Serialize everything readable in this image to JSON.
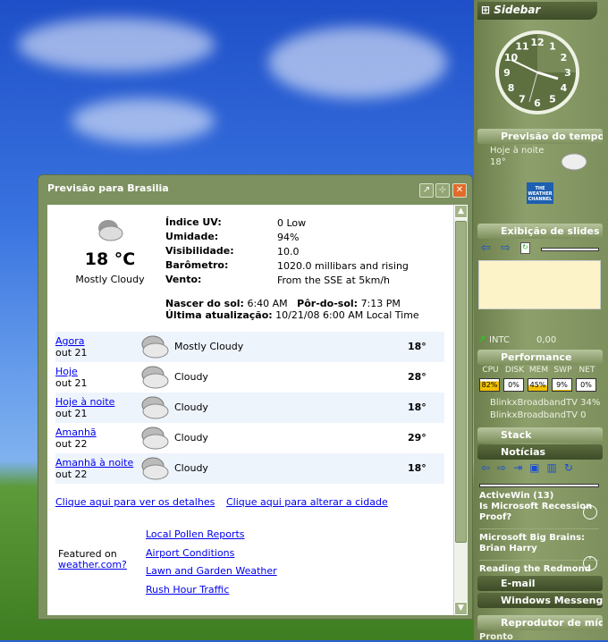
{
  "window": {
    "title": "Previsão para Brasilia",
    "buttons": {
      "undock": "↗",
      "pin": "⊹",
      "close": "✕"
    }
  },
  "current": {
    "temp": "18 °C",
    "condition": "Mostly Cloudy",
    "details": [
      {
        "label": "Índice UV:",
        "value": "0 Low"
      },
      {
        "label": "Umidade:",
        "value": "94%"
      },
      {
        "label": "Visibilidade:",
        "value": "10.0"
      },
      {
        "label": "Barômetro:",
        "value": "1020.0 millibars and rising"
      },
      {
        "label": "Vento:",
        "value": "From the SSE at 5km/h"
      }
    ],
    "sunrise_label": "Nascer do sol:",
    "sunrise": "6:40 AM",
    "sunset_label": "Pôr-do-sol:",
    "sunset": "7:13 PM",
    "updated_label": "Última atualização:",
    "updated": "10/21/08 6:00 AM Local Time"
  },
  "forecast": [
    {
      "period": "Agora",
      "date": "out 21",
      "condition": "Mostly Cloudy",
      "temp": "18°"
    },
    {
      "period": "Hoje",
      "date": "out 21",
      "condition": "Cloudy",
      "temp": "28°"
    },
    {
      "period": "Hoje à noite",
      "date": "out 21",
      "condition": "Cloudy",
      "temp": "18°"
    },
    {
      "period": "Amanhã",
      "date": "out 22",
      "condition": "Cloudy",
      "temp": "29°"
    },
    {
      "period": "Amanhã à noite",
      "date": "out 22",
      "condition": "Cloudy",
      "temp": "18°"
    }
  ],
  "links": {
    "details": "Clique aqui para ver os detalhes",
    "change_city": "Clique aqui para alterar a cidade"
  },
  "featured": {
    "text": "Featured on",
    "link": "weather.com?",
    "items": [
      "Local Pollen Reports",
      "Airport Conditions",
      "Lawn and Garden Weather",
      "Rush Hour Traffic"
    ]
  },
  "sidebar": {
    "title": "Sidebar",
    "clock_numbers": [
      "12",
      "1",
      "2",
      "3",
      "4",
      "5",
      "6",
      "7",
      "8",
      "9",
      "10",
      "11"
    ],
    "weather": {
      "header": "Previsão do tempo",
      "period": "Hoje à noite",
      "temp": "18°",
      "logo": "THE WEATHER CHANNEL",
      "logo_url": "weather.com"
    },
    "slides": {
      "header": "Exibição de slides"
    },
    "stock": {
      "symbol": "INTC",
      "value": "0,00"
    },
    "performance": {
      "header": "Performance",
      "labels": [
        "CPU",
        "DISK",
        "MEM",
        "SWP",
        "NET"
      ],
      "values": [
        "82%",
        "0%",
        "45%",
        "9%",
        "0%"
      ],
      "fill": [
        0.82,
        0,
        0.45,
        0.09,
        0
      ],
      "proc1": "BlinkxBroadbandTV 34%",
      "proc2": "BlinkxBroadbandTV 0"
    },
    "stack": {
      "header": "Stack"
    },
    "news": {
      "header": "Notícias",
      "items": [
        "ActiveWin (13)",
        "Is Microsoft Recession Proof?",
        "Microsoft Big Brains: Brian Harry",
        "Reading the Redmond"
      ]
    },
    "email": {
      "header": "E-mail"
    },
    "messenger": {
      "header": "Windows Messenger"
    },
    "media": {
      "header": "Reprodutor de mídi",
      "status": "Pronto"
    }
  }
}
